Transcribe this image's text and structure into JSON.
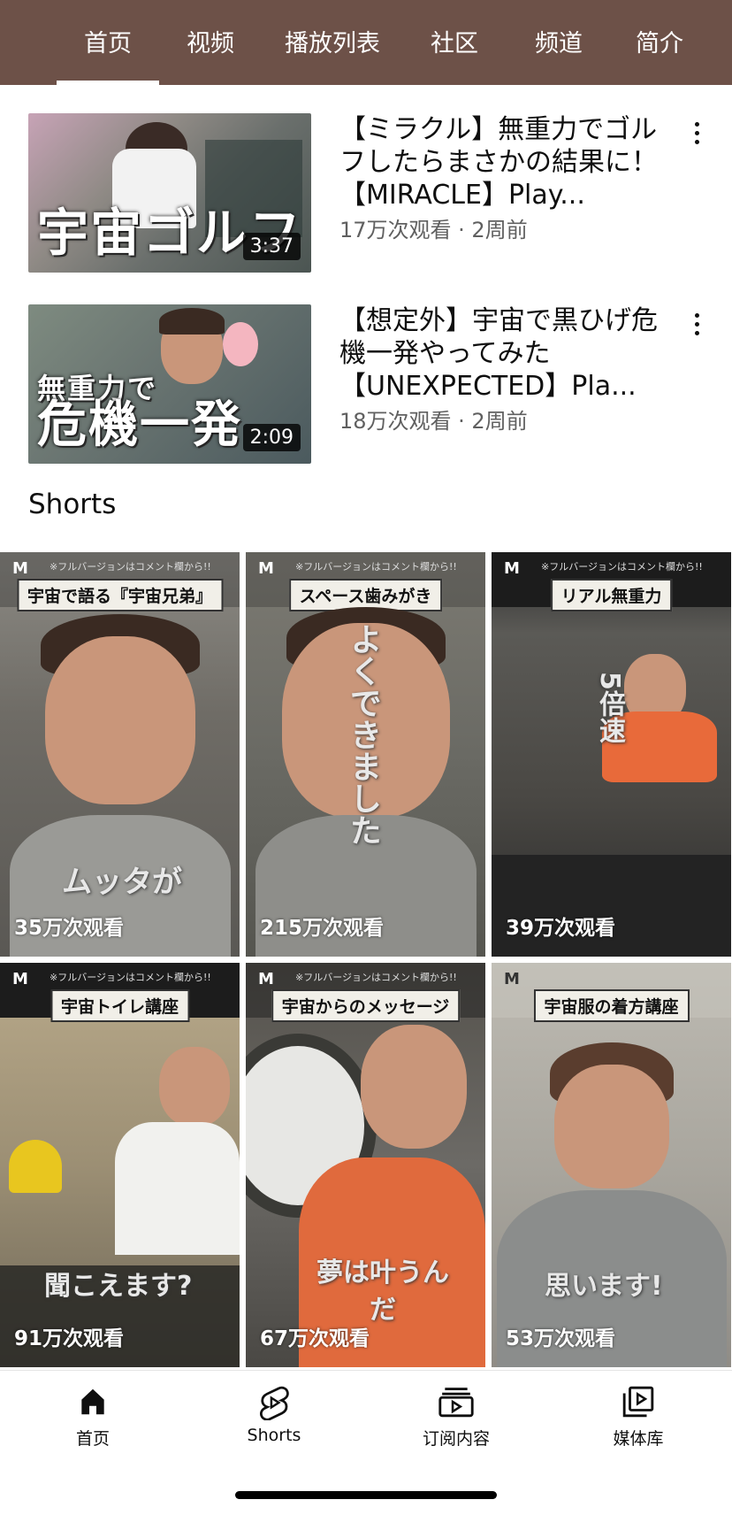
{
  "tabs": [
    {
      "label": "首页"
    },
    {
      "label": "视频"
    },
    {
      "label": "播放列表"
    },
    {
      "label": "社区"
    },
    {
      "label": "频道"
    },
    {
      "label": "简介"
    }
  ],
  "videos": [
    {
      "thumb_text": "宇宙ゴルフ",
      "duration": "3:37",
      "title": "【ミラクル】無重力でゴルフしたらまさかの結果に！ 【MIRACLE】Play...",
      "meta": "17万次观看 · 2周前"
    },
    {
      "thumb_text_top": "無重力で",
      "thumb_text": "危機一発",
      "duration": "2:09",
      "title": "【想定外】宇宙で黒ひげ危機一発やってみた【UNEXPECTED】Pla...",
      "meta": "18万次观看 · 2周前"
    }
  ],
  "shorts_section": {
    "title": "Shorts"
  },
  "shorts_note": "※フルバージョンはコメント欄から!!",
  "shorts": [
    {
      "label": "宇宙で語る『宇宙兄弟』",
      "overlay": "ムッタが",
      "views": "35万次观看"
    },
    {
      "label": "スペース歯みがき",
      "overlay": "よくできました",
      "views": "215万次观看"
    },
    {
      "label": "リアル無重力",
      "overlay": "5倍速",
      "views": "39万次观看"
    },
    {
      "label": "宇宙トイレ講座",
      "overlay": "聞こえます?",
      "views": "91万次观看"
    },
    {
      "label": "宇宙からのメッセージ",
      "overlay": "夢は叶うんだ",
      "views": "67万次观看"
    },
    {
      "label": "宇宙服の着方講座",
      "overlay": "思います!",
      "views": "53万次观看"
    }
  ],
  "bottom_nav": [
    {
      "label": "首页",
      "icon": "home-icon"
    },
    {
      "label": "Shorts",
      "icon": "shorts-icon"
    },
    {
      "label": "订阅内容",
      "icon": "subscriptions-icon"
    },
    {
      "label": "媒体库",
      "icon": "library-icon"
    }
  ],
  "colors": {
    "header_bg": "#6d5148",
    "accent": "#ffffff",
    "meta_text": "#606060"
  }
}
